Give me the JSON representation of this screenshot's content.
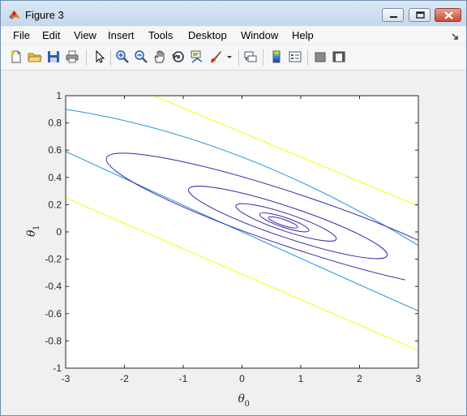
{
  "window": {
    "title": "Figure 3"
  },
  "menu": [
    "File",
    "Edit",
    "View",
    "Insert",
    "Tools",
    "Desktop",
    "Window",
    "Help"
  ],
  "toolbar": [
    "new-figure-icon",
    "open-folder-icon",
    "save-icon",
    "print-icon",
    "pointer-icon",
    "zoom-in-icon",
    "zoom-out-icon",
    "pan-hand-icon",
    "rotate-3d-icon",
    "data-cursor-icon",
    "brush-icon",
    "brush-dropdown-icon",
    "link-plot-icon",
    "colorbar-icon",
    "legend-icon",
    "hide-plot-tools-icon",
    "show-plot-tools-icon"
  ],
  "chart_data": {
    "type": "contour",
    "xlabel": "θ",
    "xlabel_sub": "0",
    "ylabel": "θ",
    "ylabel_sub": "1",
    "xlim": [
      -3,
      3
    ],
    "ylim": [
      -1,
      1
    ],
    "xticks": [
      -3,
      -2,
      -1,
      0,
      1,
      2,
      3
    ],
    "yticks": [
      -1,
      -0.8,
      -0.6,
      -0.4,
      -0.2,
      0,
      0.2,
      0.4,
      0.6,
      0.8,
      1
    ],
    "xtick_labels": [
      "-3",
      "-2",
      "-1",
      "0",
      "1",
      "2",
      "3"
    ],
    "ytick_labels": [
      "-1",
      "-0.8",
      "-0.6",
      "-0.4",
      "-0.2",
      "0",
      "0.2",
      "0.4",
      "0.6",
      "0.8",
      "1"
    ],
    "colormap": [
      "#3e26a8",
      "#1f96d6",
      "#f9fb0e"
    ],
    "contours": [
      {
        "color": "#f9fb0e",
        "lines": [
          [
            [
              -1.5,
              1.0
            ],
            [
              3.0,
              0.19
            ]
          ],
          [
            [
              -3.0,
              0.25
            ],
            [
              3.0,
              -0.87
            ]
          ]
        ]
      },
      {
        "color": "#1f96d6",
        "lines": [
          [
            [
              -3.0,
              0.9
            ],
            [
              0.0,
              0.55
            ],
            [
              3.0,
              -0.1
            ]
          ],
          [
            [
              -3.0,
              0.59
            ],
            [
              0.0,
              0.0
            ],
            [
              3.0,
              -0.58
            ]
          ]
        ]
      },
      {
        "color": "#3e26a8",
        "ellipses": [
          {
            "center": [
              0.7,
              0.07
            ],
            "rx": 0.26,
            "ry": 0.022
          },
          {
            "center": [
              0.72,
              0.07
            ],
            "rx": 0.44,
            "ry": 0.036
          },
          {
            "center": [
              0.75,
              0.07
            ],
            "rx": 0.9,
            "ry": 0.064
          },
          {
            "center": [
              0.78,
              0.07
            ],
            "rx": 1.78,
            "ry": 0.112
          },
          {
            "center": [
              0.9,
              0.08
            ],
            "rx": 3.38,
            "ry": 0.195
          }
        ]
      }
    ]
  }
}
